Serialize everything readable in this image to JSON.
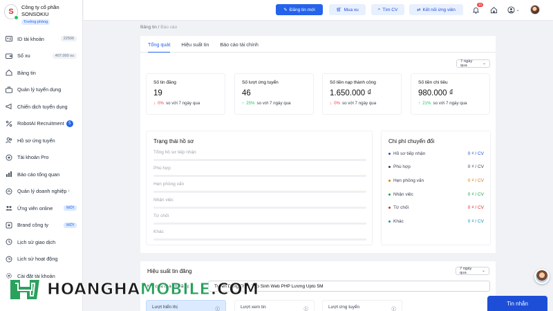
{
  "brand": {
    "logo_letter": "S",
    "name_line1": "Công ty cổ phần",
    "name_line2": "SONSOKIU",
    "role": "Trưởng phòng"
  },
  "sidebar": {
    "items": [
      {
        "label": "ID tài khoản",
        "pill": "22506",
        "icon": "id-card-icon"
      },
      {
        "label": "Số xu",
        "pill": "407.000 xu",
        "icon": "wallet-icon"
      },
      {
        "label": "Bảng tin",
        "icon": "home-icon"
      },
      {
        "label": "Quản lý tuyển dụng",
        "icon": "briefcase-icon"
      },
      {
        "label": "Chiến dịch tuyển dụng",
        "icon": "megaphone-icon"
      },
      {
        "label": "RobotAI Recruitment",
        "badge": "5",
        "icon": "percent-icon"
      },
      {
        "label": "Hồ sơ ứng tuyển",
        "icon": "users-icon"
      },
      {
        "label": "Tài khoản Pro",
        "icon": "pro-icon"
      },
      {
        "label": "Báo cáo tổng quan",
        "icon": "report-icon"
      },
      {
        "label": "Quản lý doanh nghiệp",
        "icon": "building-icon"
      },
      {
        "label": "Ứng viên online",
        "pill": "MỚI",
        "icon": "people-icon"
      },
      {
        "label": "Brand công ty",
        "pill": "MỚI",
        "icon": "brand-icon"
      },
      {
        "label": "Lịch sử giao dịch",
        "icon": "history-icon"
      },
      {
        "label": "Lịch sử hoạt động",
        "icon": "activity-icon"
      },
      {
        "label": "Cài đặt tài khoản",
        "icon": "settings-icon"
      }
    ]
  },
  "topbar": {
    "post_job": "Đăng tin mới",
    "buy_xu": "Mua xu",
    "find_cv": "Tìm CV",
    "connect": "Kết nối ứng viên",
    "notif_count": "10"
  },
  "breadcrumb": {
    "root": "Bảng tin",
    "sep": "/",
    "current": "Báo cáo"
  },
  "tabs": [
    "Tổng quát",
    "Hiệu suất tin",
    "Báo cáo tài chính"
  ],
  "period_select": "7 ngày qua",
  "stats": [
    {
      "title": "Số tin đăng",
      "value": "19",
      "change": "0%",
      "dir": "down",
      "compare": "so với 7 ngày qua"
    },
    {
      "title": "Số lượt ứng tuyển",
      "value": "46",
      "change": "25%",
      "dir": "up",
      "compare": "so với 7 ngày qua"
    },
    {
      "title": "Số tiền nạp thành công",
      "value": "1.650.000 ₫",
      "change": "0%",
      "dir": "down",
      "compare": "so với 7 ngày qua"
    },
    {
      "title": "Số tiền chi tiêu",
      "value": "980.000 ₫",
      "change": "21%",
      "dir": "up",
      "compare": "so với 7 ngày qua"
    }
  ],
  "status": {
    "title": "Trạng thái hồ sơ",
    "rows": [
      "Tổng hồ sơ tiếp nhận",
      "Phù hợp",
      "Hẹn phỏng vấn",
      "Nhận việc",
      "Từ chối",
      "Khác"
    ]
  },
  "cost": {
    "title": "Chi phí chuyển đổi",
    "rows": [
      {
        "label": "Hồ sơ tiếp nhận",
        "value": "0 ₫ / CV",
        "color": "#1d4ed8"
      },
      {
        "label": "Phù hợp",
        "value": "0 ₫ / CV",
        "color": "#374151"
      },
      {
        "label": "Hẹn phỏng vấn",
        "value": "0 ₫ / CV",
        "color": "#d97706"
      },
      {
        "label": "Nhận việc",
        "value": "0 ₫ / CV",
        "color": "#16a34a"
      },
      {
        "label": "Từ chối",
        "value": "0 ₫ / CV",
        "color": "#dc2626"
      },
      {
        "label": "Khác",
        "value": "0 ₫ / CV",
        "color": "#0891b2"
      }
    ]
  },
  "performance": {
    "title": "Hiệu suất tin đăng",
    "period": "7 ngày qua",
    "result_label": "Kết quả của tin đăng:",
    "selected_post": "Tuyển Dụng Thực Tập Sinh Web PHP Lương Upto 5M",
    "metrics": [
      "Lượt hiển thị",
      "Lượt xem tin",
      "Lượt ứng tuyển"
    ]
  },
  "chat_button": "Tin nhắn",
  "watermark": {
    "part1": "HOANGHA",
    "part2": "MOBILE",
    "part3": ".COM"
  }
}
